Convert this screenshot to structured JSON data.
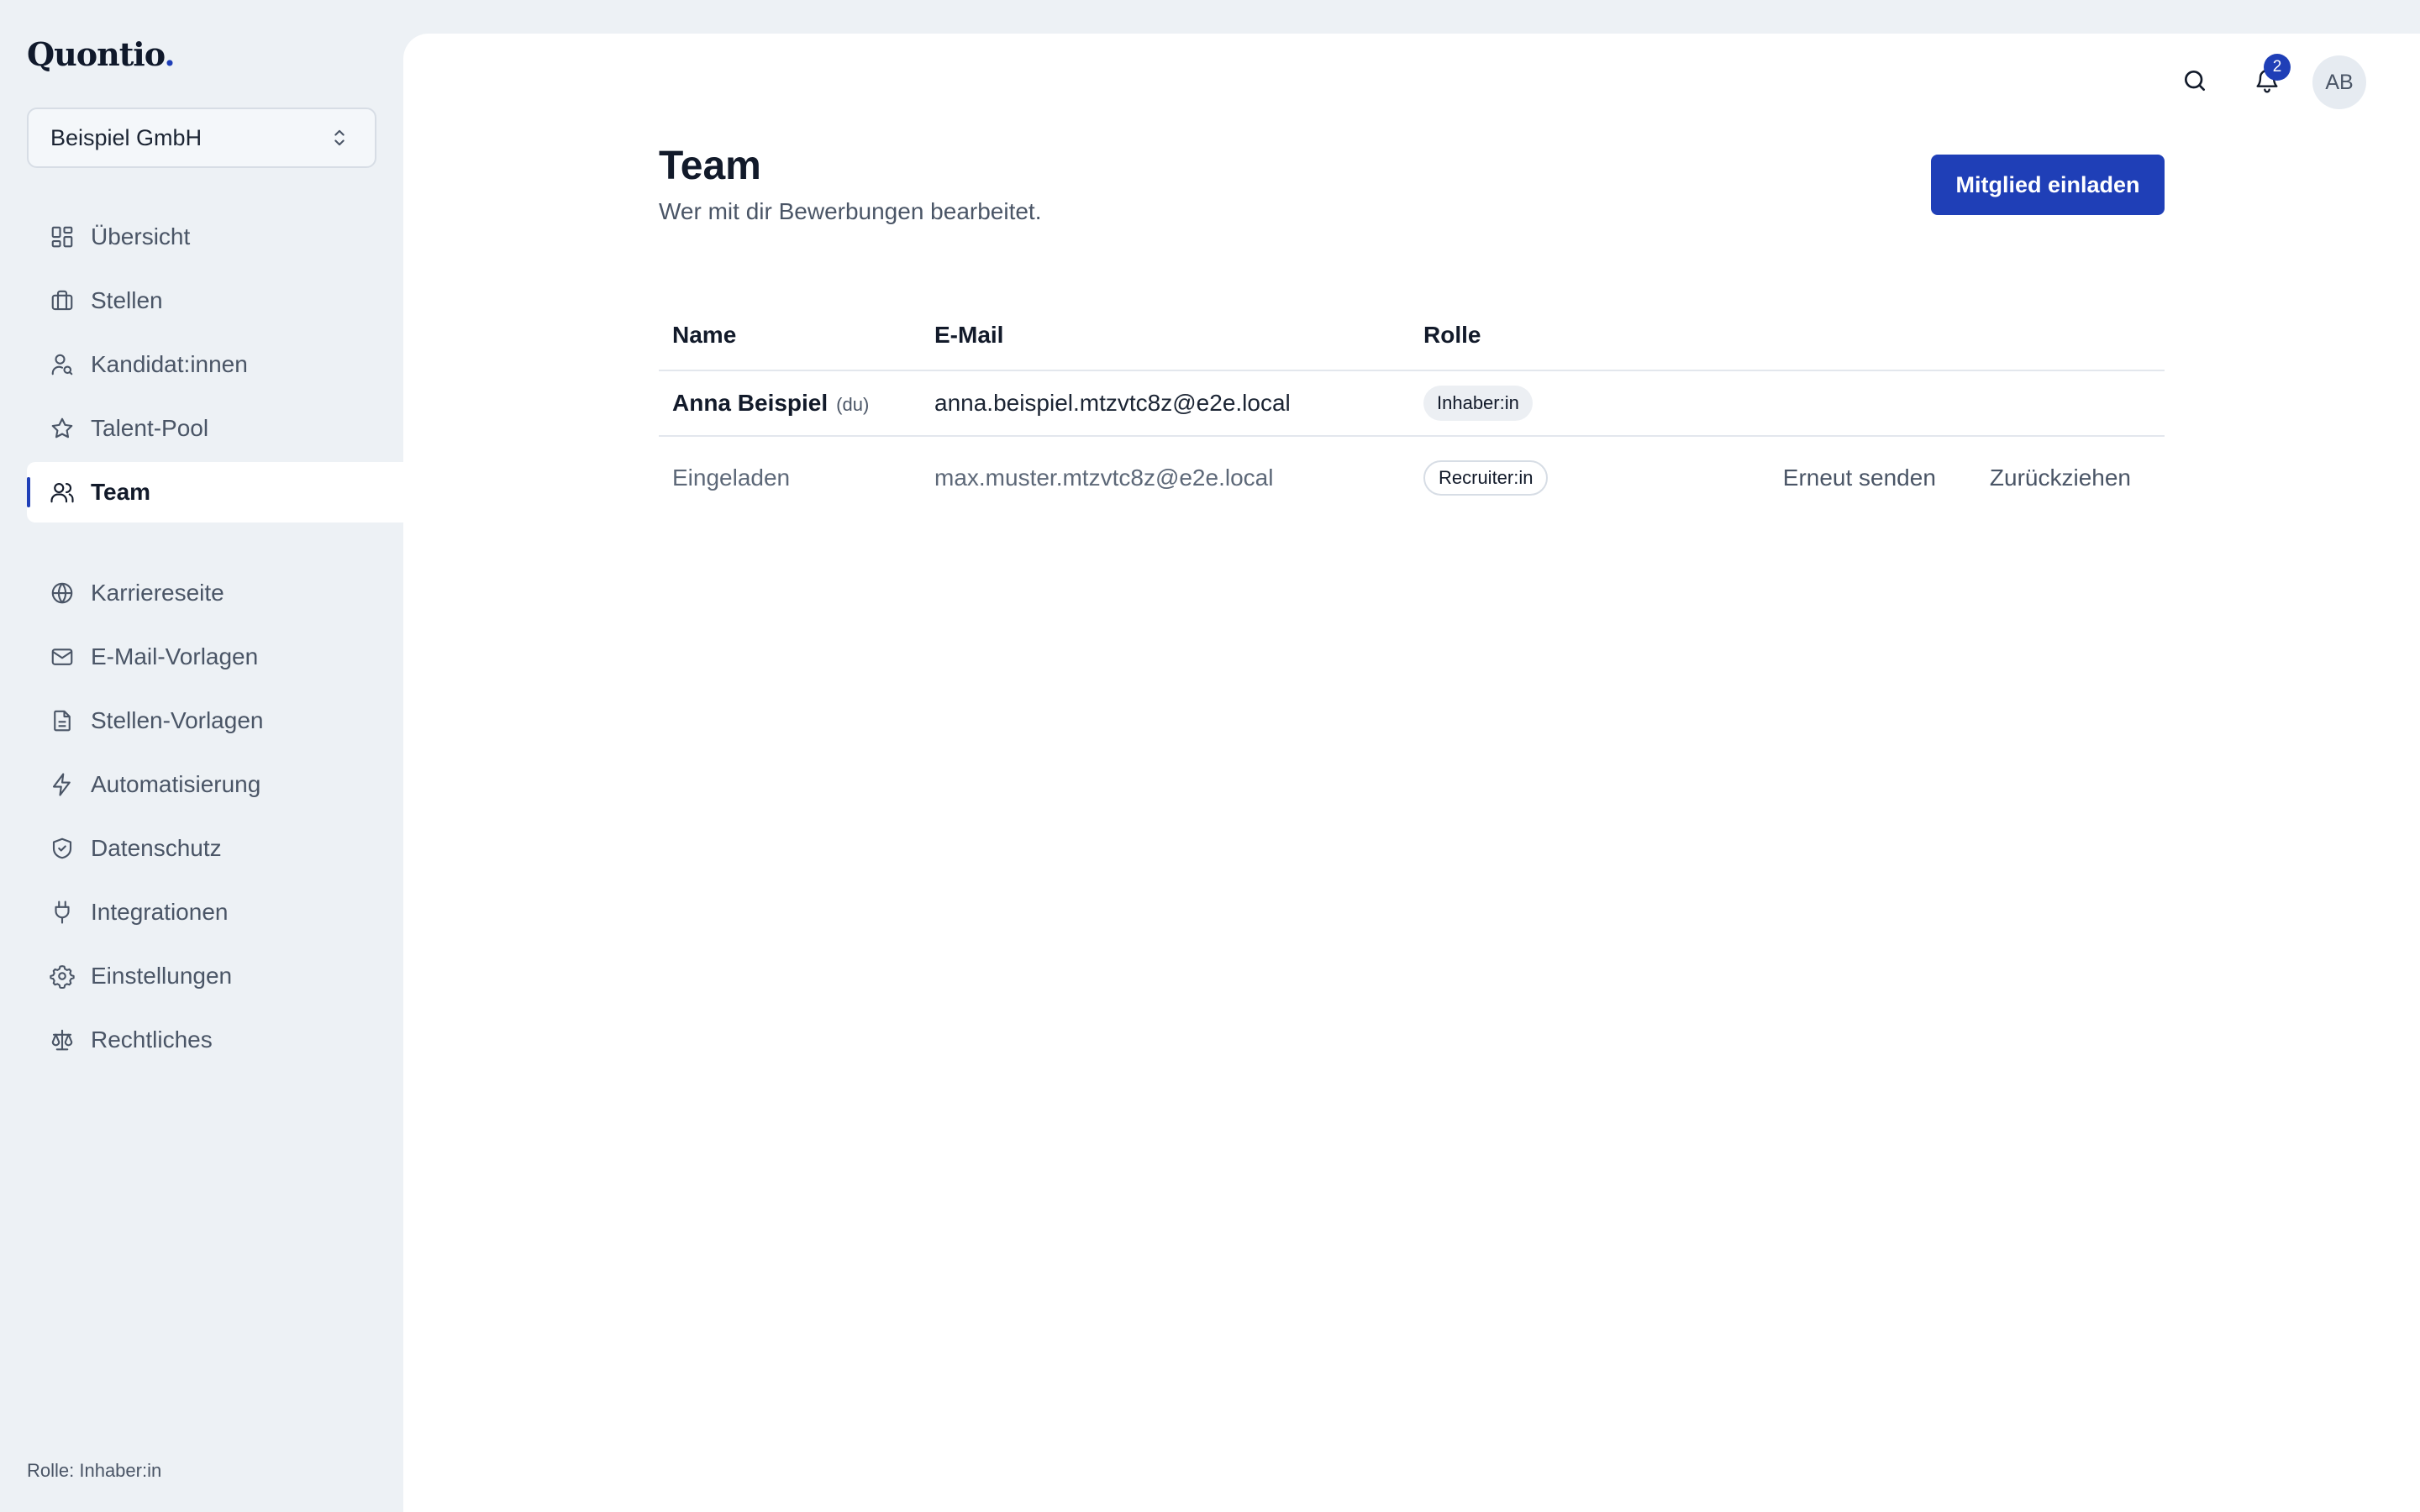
{
  "app": {
    "logo": "Quontio",
    "logo_dot": "."
  },
  "org_selector": {
    "value": "Beispiel GmbH",
    "icon": "chevron-up-down-icon"
  },
  "sidebar": {
    "primary": [
      {
        "label": "Übersicht",
        "icon": "dashboard-grid-icon"
      },
      {
        "label": "Stellen",
        "icon": "briefcase-icon"
      },
      {
        "label": "Kandidat:innen",
        "icon": "user-search-icon"
      },
      {
        "label": "Talent-Pool",
        "icon": "star-icon"
      },
      {
        "label": "Team",
        "icon": "users-icon",
        "active": true
      }
    ],
    "secondary": [
      {
        "label": "Karriereseite",
        "icon": "globe-icon"
      },
      {
        "label": "E-Mail-Vorlagen",
        "icon": "mail-icon"
      },
      {
        "label": "Stellen-Vorlagen",
        "icon": "document-icon"
      },
      {
        "label": "Automatisierung",
        "icon": "lightning-icon"
      },
      {
        "label": "Datenschutz",
        "icon": "shield-check-icon"
      },
      {
        "label": "Integrationen",
        "icon": "plug-icon"
      },
      {
        "label": "Einstellungen",
        "icon": "gear-icon"
      },
      {
        "label": "Rechtliches",
        "icon": "scale-icon"
      }
    ],
    "footer_role": "Rolle: Inhaber:in",
    "accent_color": "#1f3fb7"
  },
  "topbar": {
    "notification_count": "2",
    "avatar_initials": "AB"
  },
  "page": {
    "title": "Team",
    "subtitle": "Wer mit dir Bewerbungen bearbeitet.",
    "invite_label": "Mitglied einladen"
  },
  "table": {
    "headers": {
      "name": "Name",
      "email": "E-Mail",
      "role": "Rolle"
    },
    "rows": [
      {
        "name": "Anna Beispiel",
        "you_tag": "(du)",
        "email": "anna.beispiel.mtzvtc8z@e2e.local",
        "role": "Inhaber:in"
      },
      {
        "name": "Eingeladen",
        "email": "max.muster.mtzvtc8z@e2e.local",
        "role": "Recruiter:in",
        "action_resend": "Erneut senden",
        "action_revoke": "Zurückziehen"
      }
    ]
  }
}
